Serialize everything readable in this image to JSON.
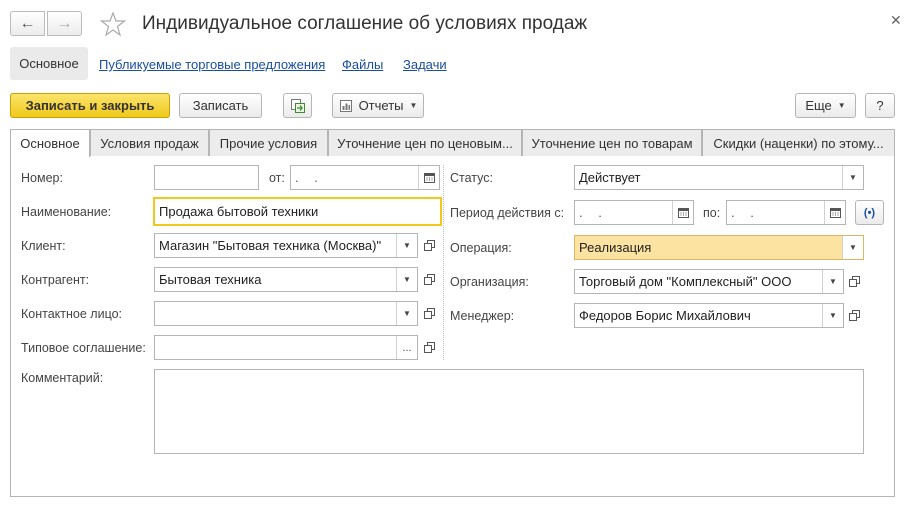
{
  "window": {
    "title": "Индивидуальное соглашение об условиях продаж"
  },
  "section_nav": {
    "active": "Основное",
    "links": [
      "Публикуемые торговые предложения",
      "Файлы",
      "Задачи"
    ]
  },
  "toolbar": {
    "save_close": "Записать и закрыть",
    "save": "Записать",
    "reports": "Отчеты",
    "more": "Еще",
    "help": "?"
  },
  "tabs": [
    "Основное",
    "Условия продаж",
    "Прочие условия",
    "Уточнение цен по ценовым...",
    "Уточнение цен по товарам",
    "Скидки (наценки) по этому..."
  ],
  "form": {
    "number_label": "Номер:",
    "number_value": "",
    "from_label": "от:",
    "from_value": ". .",
    "name_label": "Наименование:",
    "name_value": "Продажа бытовой техники",
    "client_label": "Клиент:",
    "client_value": "Магазин \"Бытовая техника (Москва)\"",
    "counterparty_label": "Контрагент:",
    "counterparty_value": "Бытовая техника",
    "contact_label": "Контактное лицо:",
    "contact_value": "",
    "template_label": "Типовое соглашение:",
    "template_value": "",
    "status_label": "Статус:",
    "status_value": "Действует",
    "period_label": "Период действия с:",
    "period_from": ". .",
    "period_to_label": "по:",
    "period_to": ". .",
    "operation_label": "Операция:",
    "operation_value": "Реализация",
    "organization_label": "Организация:",
    "organization_value": "Торговый дом \"Комплексный\" ООО",
    "manager_label": "Менеджер:",
    "manager_value": "Федоров Борис Михайлович",
    "comment_label": "Комментарий:",
    "comment_value": ""
  },
  "colors": {
    "primary_button": "#f0c91c",
    "link": "#1a4fa0",
    "highlight_field": "#fde3a2"
  }
}
